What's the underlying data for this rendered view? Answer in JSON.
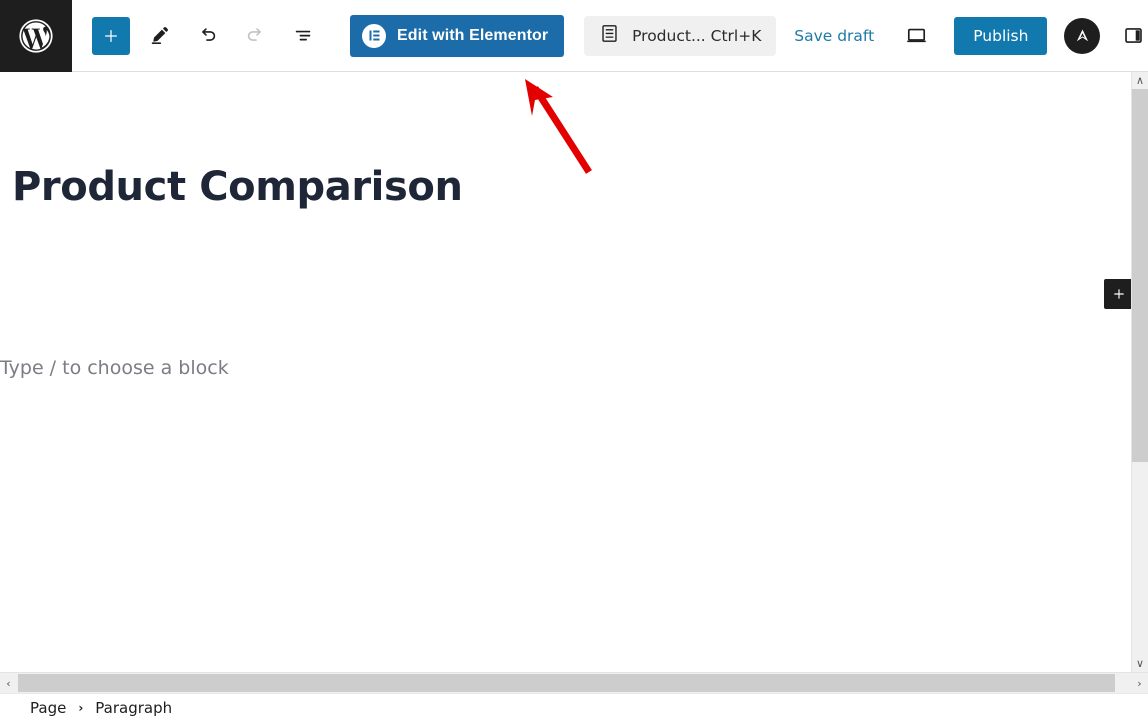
{
  "toolbar": {
    "wp_logo": "wordpress-logo",
    "add_block_label": "+",
    "add_block_title": "Toggle block inserter",
    "tools_title": "Tools",
    "undo_title": "Undo",
    "redo_title": "Redo",
    "list_view_title": "Document Overview",
    "elementor_label": "Edit with Elementor",
    "elementor_badge": "E",
    "document_label": "Product... Ctrl+K",
    "document_icon": "page-icon",
    "save_draft_label": "Save draft",
    "preview_title": "View",
    "publish_label": "Publish",
    "astra_label": "A",
    "astra_title": "Astra Settings",
    "settings_title": "Settings",
    "more_title": "Options"
  },
  "editor": {
    "post_title": "Product Comparison",
    "block_placeholder": "Type / to choose a block",
    "inserter_label": "+"
  },
  "breadcrumb": {
    "items": [
      {
        "label": "Page"
      },
      {
        "label": "Paragraph"
      }
    ],
    "separator": "›"
  },
  "scrollbars": {
    "up_glyph": "∧",
    "down_glyph": "∨",
    "left_glyph": "‹",
    "right_glyph": "›"
  },
  "annotation": {
    "type": "red-arrow",
    "color": "#e30000",
    "points_to": "Edit with Elementor"
  },
  "colors": {
    "accent_blue": "#1179ad",
    "elementor_blue": "#1b6ca8",
    "link_blue": "#1e7ba6",
    "dark": "#1e1e1e",
    "title_color": "#1e2637",
    "placeholder_gray": "#7c7c84",
    "annotation_red": "#e30000"
  }
}
